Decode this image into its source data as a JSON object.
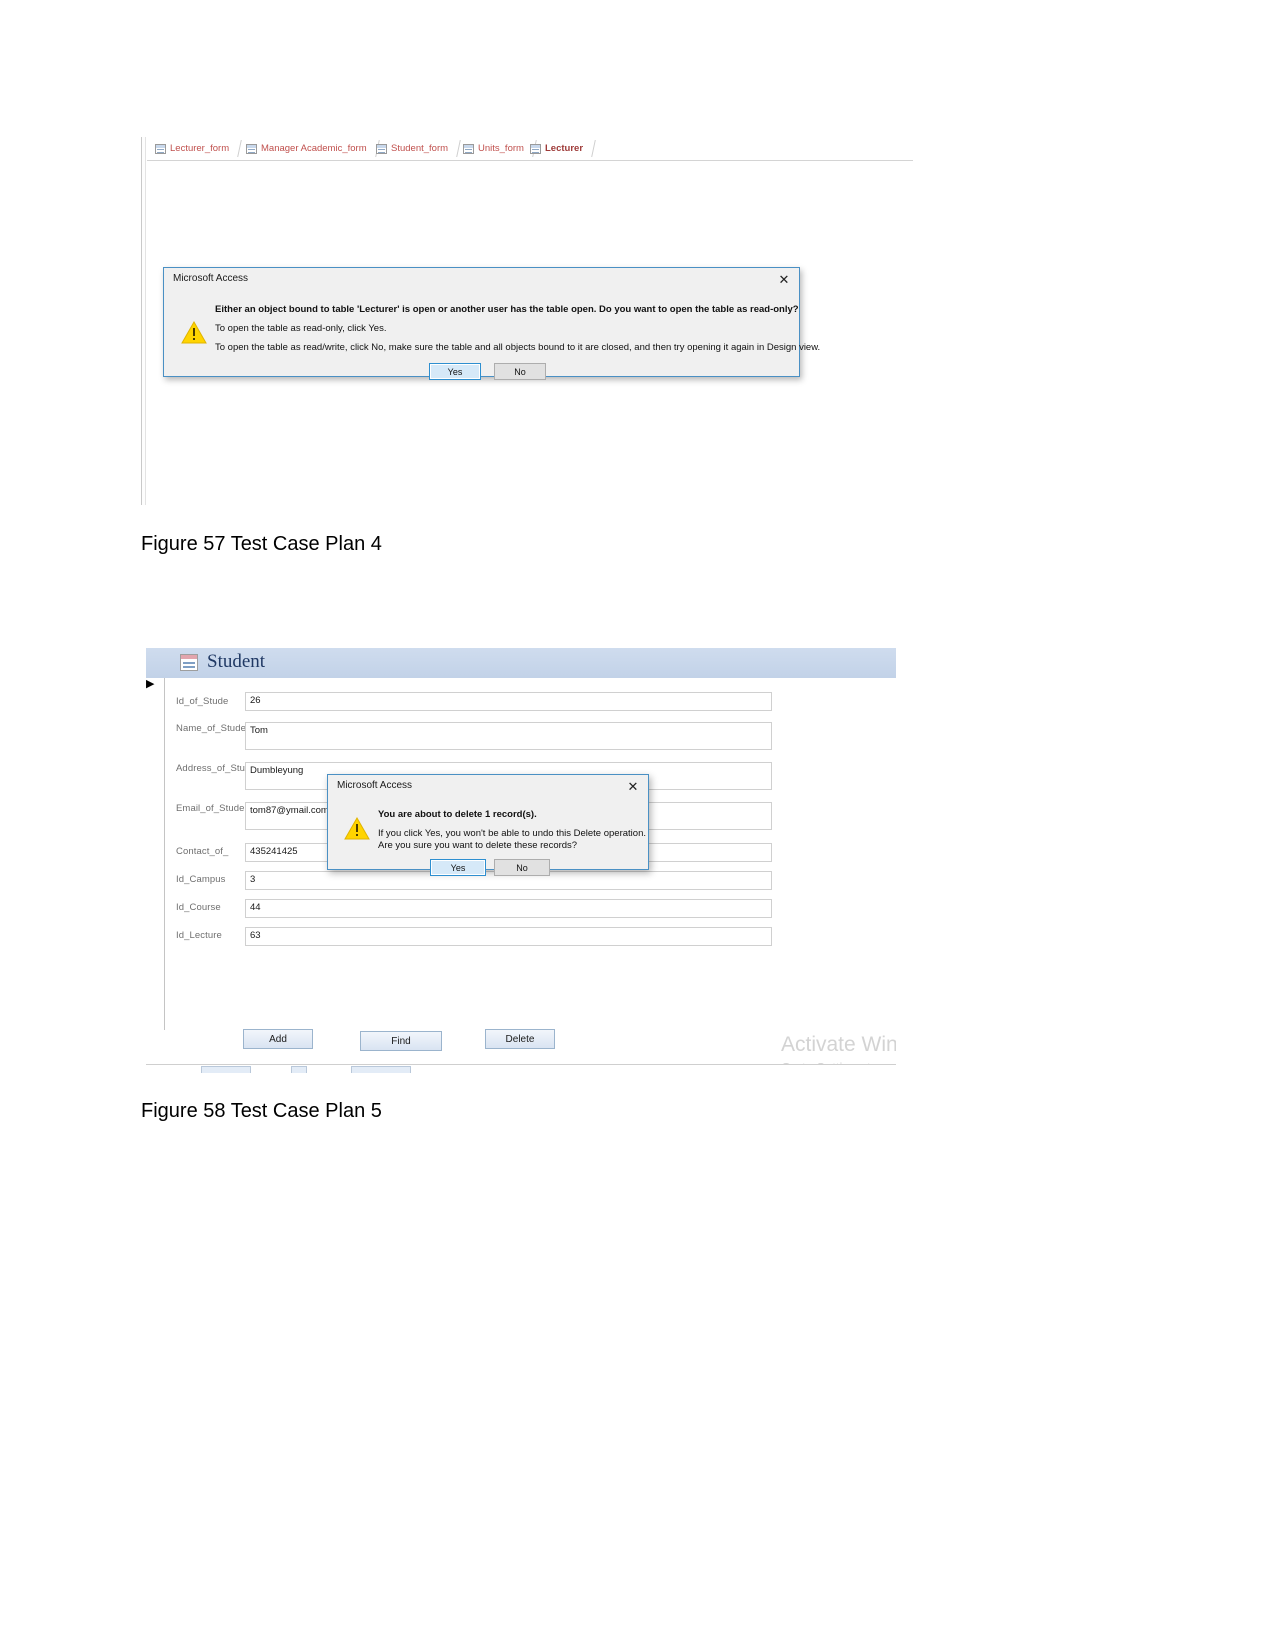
{
  "page": {
    "background": "#ffffff"
  },
  "figure1": {
    "tabs": [
      {
        "label": "Lecturer_form",
        "icon": "form-table-icon",
        "active": false
      },
      {
        "label": "Manager Academic_form",
        "icon": "form-table-icon",
        "active": false
      },
      {
        "label": "Student_form",
        "icon": "form-table-icon",
        "active": false
      },
      {
        "label": "Units_form",
        "icon": "form-table-icon",
        "active": false
      },
      {
        "label": "Lecturer",
        "icon": "table-icon",
        "active": true
      }
    ],
    "dialog": {
      "title": "Microsoft Access",
      "close_icon": "close-icon",
      "warning_icon": "warning-triangle-icon",
      "lines": [
        "Either an object bound to table 'Lecturer' is open or another user has the table open. Do you want to open the table as read-only?",
        "To open the table as read-only, click Yes.",
        "To open the table as read/write, click No, make sure the table and all objects bound to it are closed, and then try opening it again in Design view."
      ],
      "buttons": {
        "yes": "Yes",
        "no": "No"
      }
    },
    "caption": "Figure 57 Test Case Plan 4"
  },
  "figure2": {
    "form": {
      "title": "Student",
      "title_icon": "form-view-icon",
      "record_selector_icon": "record-arrow-icon",
      "fields": [
        {
          "label": "Id_of_Stude",
          "value": "26"
        },
        {
          "label": "Name_of_Student",
          "value": "Tom"
        },
        {
          "label": "Address_of_Student",
          "value": "Dumbleyung"
        },
        {
          "label": "Email_of_Student",
          "value": "tom87@ymail.com"
        },
        {
          "label": "Contact_of_",
          "value": "435241425"
        },
        {
          "label": "Id_Campus",
          "value": "3"
        },
        {
          "label": "Id_Course",
          "value": "44"
        },
        {
          "label": "Id_Lecture",
          "value": "63"
        }
      ],
      "buttons": [
        {
          "label": "Add"
        },
        {
          "label": "Find"
        },
        {
          "label": "Delete"
        }
      ]
    },
    "dialog": {
      "title": "Microsoft Access",
      "close_icon": "close-icon",
      "warning_icon": "warning-triangle-icon",
      "lines": [
        "You are about to delete 1 record(s).",
        "If you click Yes, you won't be able to undo this Delete operation.",
        "Are you sure you want to delete these records?"
      ],
      "buttons": {
        "yes": "Yes",
        "no": "No"
      }
    },
    "watermark": {
      "line1": "Activate Windows",
      "line2": "Go to Settings to activate Windows."
    },
    "caption": "Figure 58 Test Case Plan 5"
  },
  "colors": {
    "dialog_border": "#4a90c4",
    "dialog_bg": "#f0f0f0",
    "tab_text": "#c0504d",
    "form_header": "#c2d2e8",
    "form_title_text": "#1f3864",
    "warning_yellow": "#ffd400",
    "primary_button": "#d6e9f8",
    "watermark": "#d3d3d3"
  }
}
